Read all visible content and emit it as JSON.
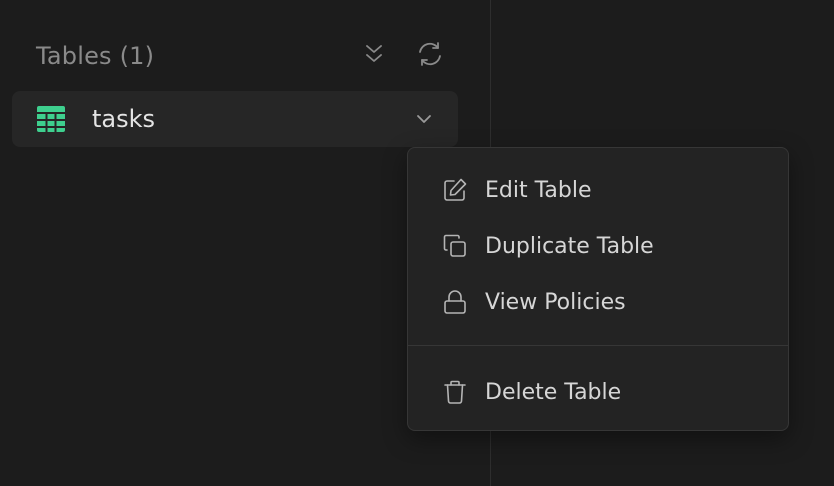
{
  "sidebar": {
    "section_title": "Tables (1)",
    "actions": [
      {
        "icon": "collapse-all-icon"
      },
      {
        "icon": "refresh-icon"
      }
    ],
    "tables": [
      {
        "name": "tasks",
        "icon": "table-grid-icon",
        "accent": "#3ecf8e"
      }
    ]
  },
  "context_menu": {
    "items": [
      {
        "label": "Edit Table",
        "icon": "edit-icon"
      },
      {
        "label": "Duplicate Table",
        "icon": "copy-icon"
      },
      {
        "label": "View Policies",
        "icon": "lock-icon"
      },
      {
        "label": "Delete Table",
        "icon": "trash-icon"
      }
    ]
  },
  "colors": {
    "background": "#1c1c1c",
    "row_background": "#262626",
    "menu_background": "#232323",
    "accent": "#3ecf8e"
  }
}
